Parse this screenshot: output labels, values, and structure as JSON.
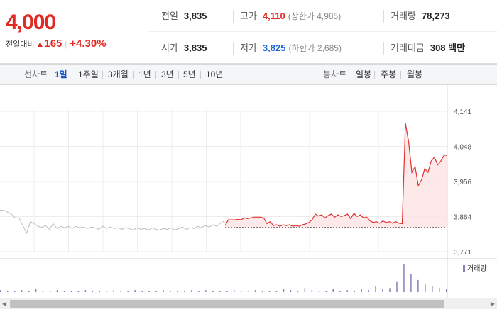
{
  "quote": {
    "price": "4,000",
    "change_label": "전일대비",
    "change_arrow": "▲",
    "change_amount": "165",
    "change_percent": "+4.30%"
  },
  "info": {
    "prev_close": {
      "label": "전일",
      "value": "3,835"
    },
    "high": {
      "label": "고가",
      "value": "4,110",
      "limit_label": "(상한가 4,985)"
    },
    "volume": {
      "label": "거래량",
      "value": "78,273"
    },
    "open": {
      "label": "시가",
      "value": "3,835"
    },
    "low": {
      "label": "저가",
      "value": "3,825",
      "limit_label": "(하한가 2,685)"
    },
    "trade_value": {
      "label": "거래대금",
      "value": "308 백만"
    }
  },
  "line_tabs": {
    "title": "선차트",
    "items": [
      "1일",
      "1주일",
      "3개월",
      "1년",
      "3년",
      "5년",
      "10년"
    ],
    "active": "1일"
  },
  "candle_tabs": {
    "title": "봉차트",
    "items": [
      "일봉",
      "주봉",
      "월봉"
    ]
  },
  "colors": {
    "up": "#e12a25",
    "down": "#1763d8",
    "today_line": "#e0312f",
    "today_fill": "#fde4e4",
    "prev_line": "#bdbdbd",
    "volume_bar": "#8d7db7",
    "grid": "#ececec"
  },
  "chart_data": {
    "type": "line",
    "y_ticks": [
      "4,141",
      "4,048",
      "3,956",
      "3,864",
      "3,771"
    ],
    "ylim": [
      3771,
      4141
    ],
    "volume_legend": "거래량",
    "baseline": 3835,
    "prev_day_series": [
      3880,
      3880,
      3875,
      3870,
      3860,
      3860,
      3840,
      3820,
      3850,
      3845,
      3838,
      3835,
      3840,
      3830,
      3845,
      3832,
      3838,
      3834,
      3838,
      3832,
      3838,
      3834,
      3836,
      3832,
      3836,
      3834,
      3830,
      3838,
      3832,
      3836,
      3832,
      3834,
      3830,
      3834,
      3832,
      3828,
      3834,
      3830,
      3832,
      3828,
      3834,
      3830,
      3828,
      3832,
      3830,
      3834,
      3828,
      3832,
      3836,
      3830,
      3834,
      3832,
      3838,
      3834,
      3840,
      3836,
      3842,
      3838,
      3846,
      3852
    ],
    "today_series": [
      3840,
      3855,
      3855,
      3855,
      3856,
      3855,
      3860,
      3858,
      3860,
      3862,
      3862,
      3862,
      3860,
      3845,
      3850,
      3840,
      3842,
      3838,
      3842,
      3840,
      3842,
      3838,
      3840,
      3838,
      3842,
      3844,
      3848,
      3855,
      3870,
      3865,
      3868,
      3860,
      3866,
      3870,
      3862,
      3868,
      3864,
      3866,
      3870,
      3858,
      3872,
      3864,
      3868,
      3860,
      3862,
      3852,
      3848,
      3850,
      3846,
      3852,
      3848,
      3850,
      3846,
      3850,
      3846,
      3845,
      4110,
      4060,
      3980,
      3995,
      3945,
      3960,
      3990,
      3980,
      4010,
      4020,
      4000,
      4010,
      4025,
      4025
    ],
    "volume": [
      2,
      1,
      1,
      2,
      1,
      3,
      1,
      1,
      2,
      1,
      1,
      1,
      2,
      1,
      1,
      1,
      2,
      1,
      1,
      2,
      1,
      1,
      1,
      2,
      1,
      1,
      1,
      2,
      1,
      2,
      1,
      1,
      1,
      2,
      1,
      1,
      2,
      1,
      1,
      1,
      3,
      2,
      1,
      4,
      2,
      1,
      1,
      3,
      1,
      2,
      1,
      3,
      2,
      6,
      3,
      4,
      10,
      28,
      18,
      12,
      8,
      6,
      4,
      3
    ]
  }
}
